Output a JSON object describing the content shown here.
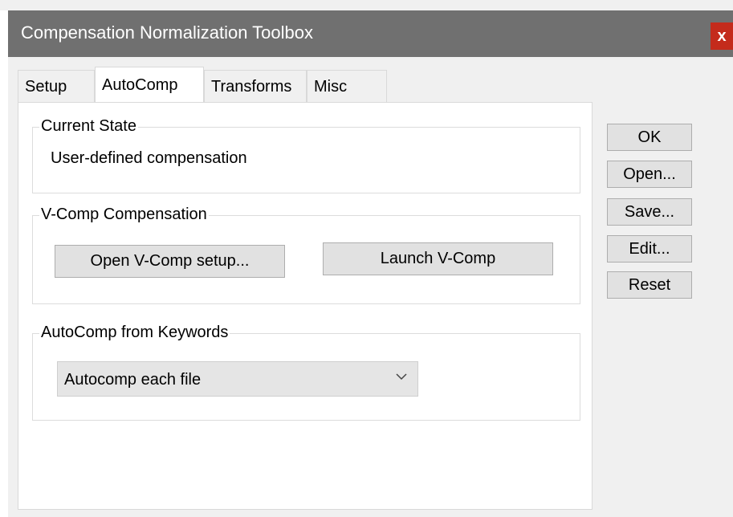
{
  "window": {
    "title": "Compensation Normalization Toolbox",
    "close_label": "x"
  },
  "tabs": [
    {
      "label": "Setup",
      "active": false
    },
    {
      "label": "AutoComp",
      "active": true
    },
    {
      "label": "Transforms",
      "active": false
    },
    {
      "label": "Misc",
      "active": false
    }
  ],
  "current_state": {
    "label": "Current State",
    "value": "User-defined compensation"
  },
  "vcomp": {
    "label": "V-Comp Compensation",
    "open_setup_label": "Open V-Comp setup...",
    "launch_label": "Launch V-Comp"
  },
  "autocomp_keywords": {
    "label": "AutoComp from Keywords",
    "selected": "Autocomp each file"
  },
  "side_buttons": {
    "ok": "OK",
    "open": "Open...",
    "save": "Save...",
    "edit": "Edit...",
    "reset": "Reset"
  },
  "colors": {
    "titlebar": "#707070",
    "close": "#c42b1c",
    "button": "#e1e1e1"
  }
}
